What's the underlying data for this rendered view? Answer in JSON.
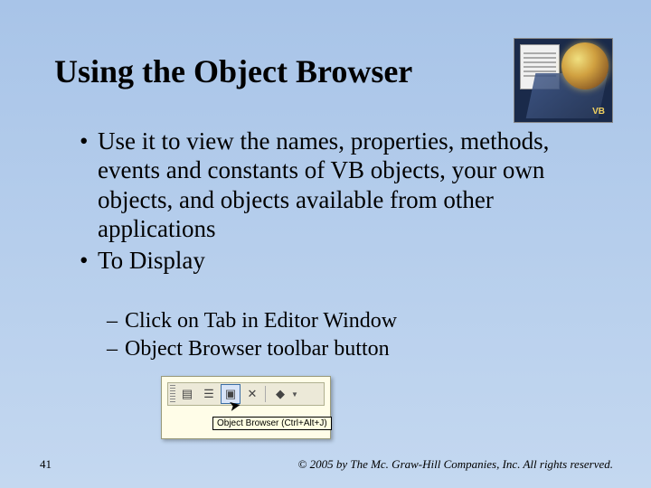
{
  "title": "Using the Object Browser",
  "bullets": [
    "Use it to view the names, properties, methods, events and constants of VB objects, your own objects, and objects available from other applications",
    "To Display"
  ],
  "sub_bullets": [
    "Click on Tab in Editor Window",
    "Object Browser toolbar button"
  ],
  "corner_vb": "VB",
  "toolbar": {
    "tooltip": "Object Browser (Ctrl+Alt+J)",
    "buttons": [
      {
        "name": "project-icon",
        "glyph": "▤",
        "selected": false
      },
      {
        "name": "properties-icon",
        "glyph": "☰",
        "selected": false
      },
      {
        "name": "object-browser-icon",
        "glyph": "▣",
        "selected": true
      },
      {
        "name": "toolbox-icon",
        "glyph": "✕",
        "selected": false
      }
    ],
    "extra_glyph": "◆"
  },
  "page_number": "41",
  "copyright": "© 2005 by The Mc. Graw-Hill Companies, Inc. All rights reserved."
}
